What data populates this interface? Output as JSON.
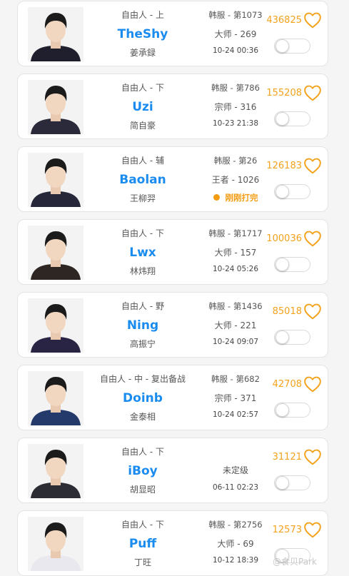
{
  "colors": {
    "accent": "#1a8cf0",
    "favorite": "#f3a21b",
    "live": "#f39c12"
  },
  "icons": {
    "favorite": "heart-outline-icon",
    "toggle": "toggle-switch"
  },
  "players": [
    {
      "tag": "自由人 - 上",
      "name": "TheShy",
      "cname": "姜承録",
      "server": "韩服 - 第1073",
      "rank": "大师 - 269",
      "time": "10-24 00:36",
      "favorites": "436825",
      "notify": false
    },
    {
      "tag": "自由人 - 下",
      "name": "Uzi",
      "cname": "简自豪",
      "server": "韩服 - 第786",
      "rank": "宗师 - 316",
      "time": "10-23 21:38",
      "favorites": "155208",
      "notify": false
    },
    {
      "tag": "自由人 - 辅",
      "name": "Baolan",
      "cname": "王柳羿",
      "server": "韩服 - 第26",
      "rank": "王者 - 1026",
      "status": "刚刚打完",
      "favorites": "126183",
      "notify": false
    },
    {
      "tag": "自由人 - 下",
      "name": "Lwx",
      "cname": "林炜翔",
      "server": "韩服 - 第1717",
      "rank": "大师 - 157",
      "time": "10-24 05:26",
      "favorites": "100036",
      "notify": false
    },
    {
      "tag": "自由人 - 野",
      "name": "Ning",
      "cname": "高振宁",
      "server": "韩服 - 第1436",
      "rank": "大师 - 221",
      "time": "10-24 09:07",
      "favorites": "85018",
      "notify": false
    },
    {
      "tag": "自由人 - 中 - 复出备战",
      "name": "Doinb",
      "cname": "金泰相",
      "server": "韩服 - 第682",
      "rank": "宗师 - 371",
      "time": "10-24 02:57",
      "favorites": "42708",
      "notify": false
    },
    {
      "tag": "自由人 - 下",
      "name": "iBoy",
      "cname": "胡显昭",
      "unranked": "未定级",
      "time": "06-11 02:23",
      "favorites": "31121",
      "notify": false
    },
    {
      "tag": "自由人 - 下",
      "name": "Puff",
      "cname": "丁旺",
      "server": "韩服 - 第2756",
      "rank": "大师 - 69",
      "time": "10-12 18:39",
      "favorites": "12573",
      "notify": false
    }
  ],
  "watermark": "@食贝Park"
}
